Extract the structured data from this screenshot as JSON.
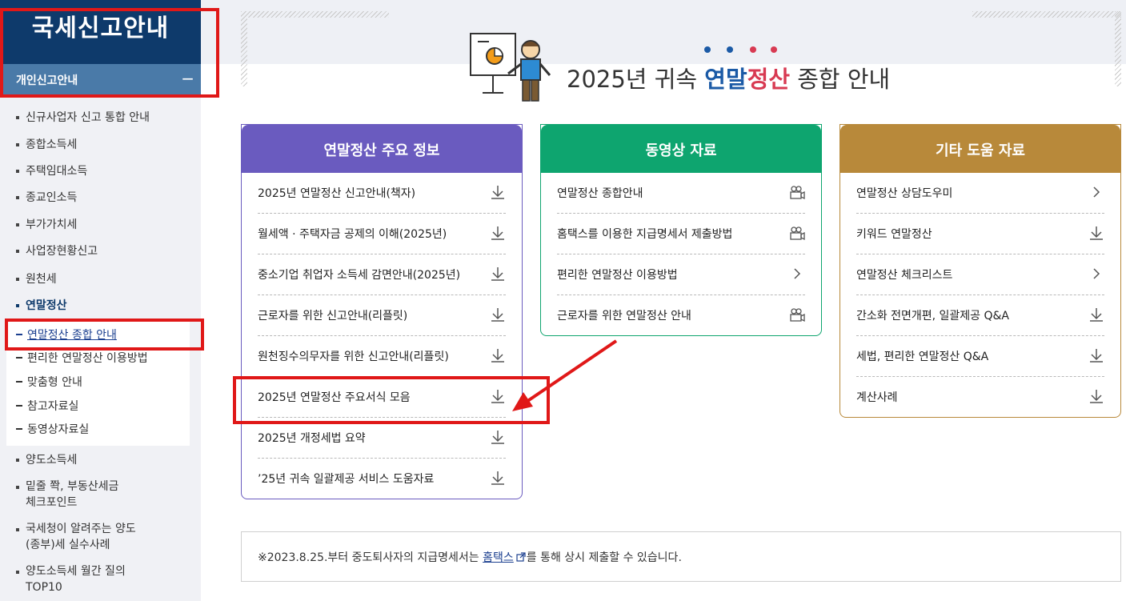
{
  "sidebar": {
    "title": "국세신고안내",
    "section": "개인신고안내",
    "toggle": "−",
    "items": [
      {
        "label": "신규사업자 신고 통합 안내"
      },
      {
        "label": "종합소득세"
      },
      {
        "label": "주택임대소득"
      },
      {
        "label": "종교인소득"
      },
      {
        "label": "부가가치세"
      },
      {
        "label": "사업장현황신고"
      },
      {
        "label": "원천세"
      },
      {
        "label": "연말정산"
      }
    ],
    "subitems": [
      {
        "label": "연말정산 종합 안내"
      },
      {
        "label": "편리한 연말정산 이용방법"
      },
      {
        "label": "맞춤형 안내"
      },
      {
        "label": "참고자료실"
      },
      {
        "label": "동영상자료실"
      }
    ],
    "items_after": [
      {
        "line1": "양도소득세",
        "line2": ""
      },
      {
        "line1": "밑줄 쫙, 부동산세금",
        "line2": "체크포인트"
      },
      {
        "line1": "국세청이 알려주는 양도",
        "line2": "(종부)세 실수사례"
      },
      {
        "line1": "양도소득세 월간 질의",
        "line2": "TOP10"
      }
    ]
  },
  "header": {
    "title_prefix": "2025년 귀속 ",
    "title_blue": "연말",
    "title_red": "정산",
    "title_suffix": " 종합 안내",
    "dot_colors": [
      "#1b5aa6",
      "#1b5aa6",
      "#d83a52",
      "#d83a52"
    ]
  },
  "cards": [
    {
      "title": "연말정산 주요 정보",
      "color": "#6a5bbf",
      "rows": [
        {
          "label": "2025년 연말정산 신고안내(책자)",
          "icon": "download-icon"
        },
        {
          "label": "월세액 · 주택자금 공제의 이해(2025년)",
          "icon": "download-icon"
        },
        {
          "label": "중소기업 취업자 소득세 감면안내(2025년)",
          "icon": "download-icon"
        },
        {
          "label": "근로자를 위한 신고안내(리플릿)",
          "icon": "download-icon"
        },
        {
          "label": "원천징수의무자를 위한 신고안내(리플릿)",
          "icon": "download-icon"
        },
        {
          "label": "2025년 연말정산 주요서식 모음",
          "icon": "download-icon"
        },
        {
          "label": "2025년 개정세법 요약",
          "icon": "download-icon"
        },
        {
          "label": "’25년 귀속 일괄제공 서비스 도움자료",
          "icon": "download-icon"
        }
      ]
    },
    {
      "title": "동영상 자료",
      "color": "#0ea56f",
      "rows": [
        {
          "label": "연말정산 종합안내",
          "icon": "video-icon"
        },
        {
          "label": "홈택스를 이용한 지급명세서 제출방법",
          "icon": "video-icon"
        },
        {
          "label": "편리한 연말정산 이용방법",
          "icon": "chevron-right-icon"
        },
        {
          "label": "근로자를 위한 연말정산 안내",
          "icon": "video-icon"
        }
      ]
    },
    {
      "title": "기타 도움 자료",
      "color": "#b8893a",
      "rows": [
        {
          "label": "연말정산 상담도우미",
          "icon": "chevron-right-icon"
        },
        {
          "label": "키워드 연말정산",
          "icon": "download-icon"
        },
        {
          "label": "연말정산 체크리스트",
          "icon": "chevron-right-icon"
        },
        {
          "label": "간소화 전면개편, 일괄제공 Q&A",
          "icon": "download-icon"
        },
        {
          "label": "세법, 편리한 연말정산 Q&A",
          "icon": "download-icon"
        },
        {
          "label": "계산사례",
          "icon": "download-icon"
        }
      ]
    }
  ],
  "notice": {
    "prefix": "※2023.8.25.부터 중도퇴사자의 지급명세서는 ",
    "link": "홈택스",
    "suffix": "를 통해 상시 제출할 수 있습니다."
  }
}
